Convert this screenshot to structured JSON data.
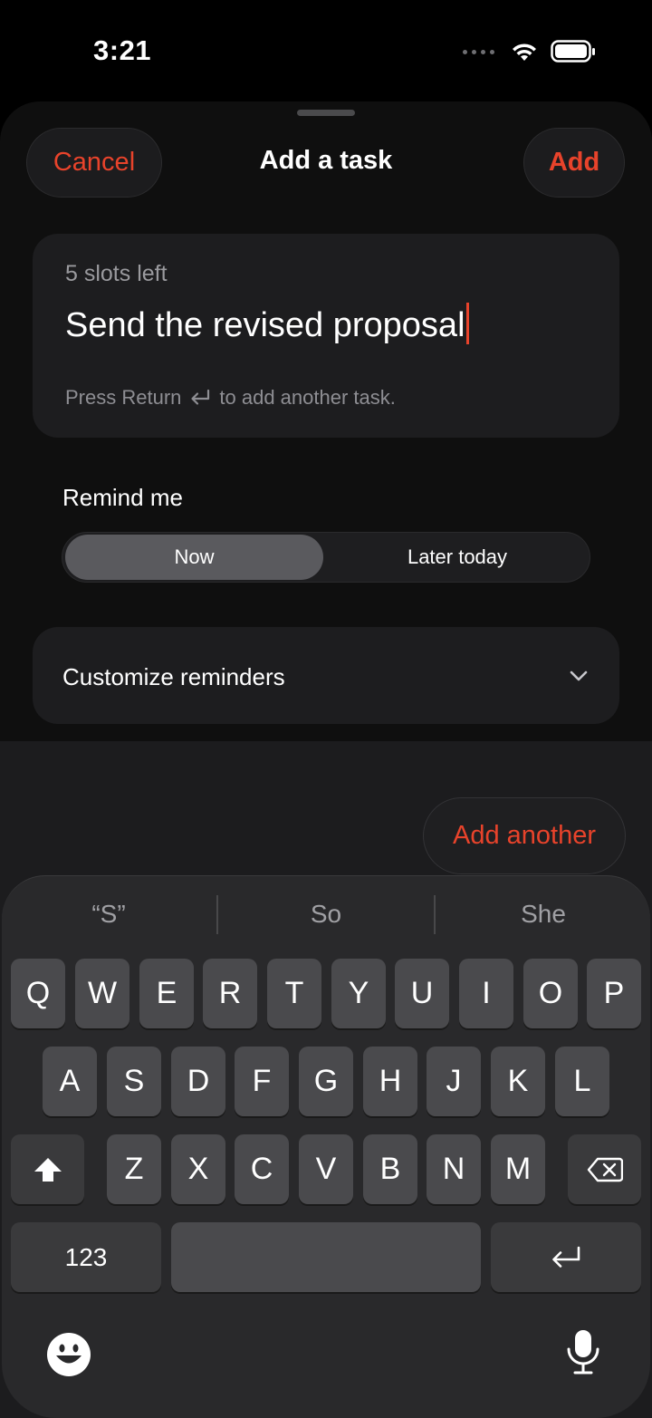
{
  "status": {
    "time": "3:21"
  },
  "sheet": {
    "cancel": "Cancel",
    "title": "Add a task",
    "add": "Add"
  },
  "task": {
    "slots": "5 slots left",
    "value": "Send the revised proposal",
    "hint_before": "Press Return",
    "hint_after": "to add another task."
  },
  "remind": {
    "label": "Remind me",
    "options": [
      "Now",
      "Later today"
    ],
    "selected": "Now"
  },
  "customize": {
    "label": "Customize reminders"
  },
  "add_another": "Add another",
  "keyboard": {
    "suggestions": [
      "“S”",
      "So",
      "She"
    ],
    "row1": [
      "Q",
      "W",
      "E",
      "R",
      "T",
      "Y",
      "U",
      "I",
      "O",
      "P"
    ],
    "row2": [
      "A",
      "S",
      "D",
      "F",
      "G",
      "H",
      "J",
      "K",
      "L"
    ],
    "row3": [
      "Z",
      "X",
      "C",
      "V",
      "B",
      "N",
      "M"
    ],
    "numbers": "123"
  },
  "colors": {
    "accent": "#e8432b"
  }
}
